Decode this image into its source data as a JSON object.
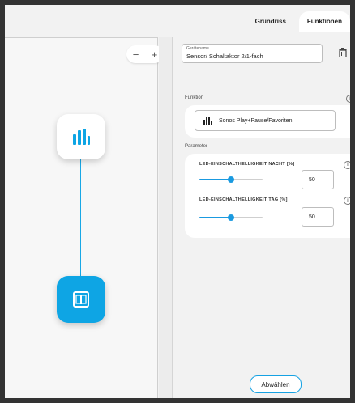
{
  "tabs": [
    {
      "label": "Grundriss",
      "active": false
    },
    {
      "label": "Funktionen",
      "active": true
    }
  ],
  "canvas": {
    "zoom_out_label": "−",
    "zoom_in_label": "+",
    "nodes": [
      {
        "name": "sonos-node",
        "icon": "bar-chart-icon"
      },
      {
        "name": "sensor-node",
        "icon": "switch-icon"
      }
    ],
    "accent": "#0ea5e4"
  },
  "device": {
    "name_caption": "Gerätename",
    "name_value": "Sensor/ Schaltaktor 2/1-fach",
    "delete_icon": "trash-icon"
  },
  "function_section": {
    "label": "Funktion",
    "value": "Sonos Play+Pause/Favoriten",
    "icon": "bar-chart-icon"
  },
  "parameters_section": {
    "label": "Parameter",
    "params": [
      {
        "title": "LED-EINSCHALTHELLIGKEIT NACHT [%]",
        "value": "50",
        "level": 0.5
      },
      {
        "title": "LED-EINSCHALTHELLIGKEIT TAG [%]",
        "value": "50",
        "level": 0.5
      }
    ]
  },
  "deselect_button": "Abwählen"
}
